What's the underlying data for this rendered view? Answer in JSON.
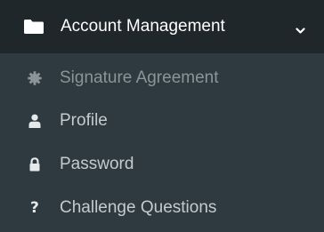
{
  "menu": {
    "header": {
      "title": "Account Management",
      "icon": "folder-icon",
      "toggle_icon": "chevron-down-icon"
    },
    "items": [
      {
        "label": "Signature Agreement",
        "icon": "gear-icon"
      },
      {
        "label": "Profile",
        "icon": "user-icon"
      },
      {
        "label": "Password",
        "icon": "lock-icon"
      },
      {
        "label": "Challenge Questions",
        "icon": "question-icon"
      }
    ]
  },
  "colors": {
    "header_background": "#1f272b",
    "menu_background": "#2f3a40",
    "header_text": "#ffffff",
    "item_text": "#c4cbce",
    "muted_item_text": "#8a9499"
  }
}
